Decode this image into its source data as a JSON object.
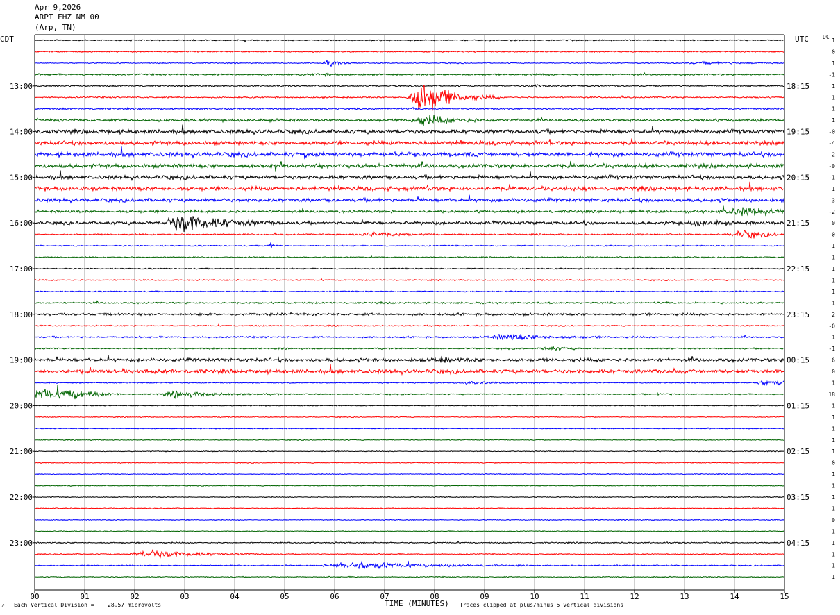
{
  "header": {
    "date": "Apr 9,2026",
    "station": "ARPT EHZ NM 00",
    "location": "(Arp, TN)"
  },
  "left_zone_label": "CDT",
  "right_zone_label": "UTC",
  "dc_label": "DC",
  "footer": {
    "scale_label": "Each Vertical Division =",
    "scale_value": "28.57 microvolts",
    "xlabel": "TIME (MINUTES)",
    "clip_note": "Traces clipped at plus/minus 5 vertical divisions",
    "corner_mark": "↗"
  },
  "colors": {
    "trace_cycle": [
      "#000000",
      "#ff0000",
      "#0000ff",
      "#006400"
    ],
    "grid": "#a0a0a0",
    "axis": "#000000"
  },
  "chart_data": {
    "type": "line",
    "title": "",
    "xlabel": "TIME (MINUTES)",
    "x_ticks": [
      "00",
      "01",
      "02",
      "03",
      "04",
      "05",
      "06",
      "07",
      "08",
      "09",
      "10",
      "11",
      "12",
      "13",
      "14",
      "15"
    ],
    "xlim": [
      0,
      15
    ],
    "trace_count": 48,
    "left_hour_labels": [
      {
        "trace": 4,
        "label": "13:00"
      },
      {
        "trace": 8,
        "label": "14:00"
      },
      {
        "trace": 12,
        "label": "15:00"
      },
      {
        "trace": 16,
        "label": "16:00"
      },
      {
        "trace": 20,
        "label": "17:00"
      },
      {
        "trace": 24,
        "label": "18:00"
      },
      {
        "trace": 28,
        "label": "19:00"
      },
      {
        "trace": 32,
        "label": "20:00"
      },
      {
        "trace": 36,
        "label": "21:00"
      },
      {
        "trace": 40,
        "label": "22:00"
      },
      {
        "trace": 44,
        "label": "23:00"
      }
    ],
    "right_hour_labels": [
      {
        "trace": 4,
        "label": "18:15"
      },
      {
        "trace": 8,
        "label": "19:15"
      },
      {
        "trace": 12,
        "label": "20:15"
      },
      {
        "trace": 16,
        "label": "21:15"
      },
      {
        "trace": 20,
        "label": "22:15"
      },
      {
        "trace": 24,
        "label": "23:15"
      },
      {
        "trace": 28,
        "label": "00:15"
      },
      {
        "trace": 32,
        "label": "01:15"
      },
      {
        "trace": 36,
        "label": "02:15"
      },
      {
        "trace": 40,
        "label": "03:15"
      },
      {
        "trace": 44,
        "label": "04:15"
      }
    ],
    "dc_offsets": [
      "1",
      "0",
      "1",
      "-1",
      "1",
      "1",
      "1",
      "1",
      "-0",
      "-4",
      "2",
      "-0",
      "-1",
      "1",
      "3",
      "-2",
      "0",
      "-0",
      "1",
      "1",
      "1",
      "1",
      "1",
      "1",
      "2",
      "-0",
      "1",
      "-1",
      "6",
      "0",
      "1",
      "18",
      "1",
      "1",
      "1",
      "1",
      "1",
      "0",
      "1",
      "1",
      "1",
      "1",
      "0",
      "1",
      "1",
      "1",
      "1",
      "1"
    ],
    "noise_levels": [
      1.0,
      1.0,
      0.8,
      1.4,
      1.2,
      1.2,
      1.4,
      2.2,
      3.2,
      3.2,
      3.6,
      3.4,
      3.2,
      3.2,
      3.0,
      2.2,
      2.6,
      1.2,
      1.0,
      1.0,
      1.0,
      1.0,
      1.0,
      1.4,
      2.0,
      1.0,
      1.4,
      1.2,
      2.8,
      3.4,
      0.9,
      1.0,
      0.7,
      0.7,
      0.7,
      0.7,
      0.7,
      0.7,
      0.7,
      0.7,
      0.7,
      0.7,
      0.7,
      0.7,
      1.0,
      0.9,
      0.9,
      0.8
    ],
    "events": [
      {
        "trace": 2,
        "minute": 5.9,
        "amplitude": 5,
        "duration": 0.3
      },
      {
        "trace": 2,
        "minute": 13.6,
        "amplitude": 2,
        "duration": 1.5
      },
      {
        "trace": 3,
        "minute": 5.7,
        "amplitude": 3,
        "duration": 0.3
      },
      {
        "trace": 4,
        "minute": 10.0,
        "amplitude": 3,
        "duration": 0.4
      },
      {
        "trace": 5,
        "minute": 7.8,
        "amplitude": 40,
        "duration": 0.6
      },
      {
        "trace": 7,
        "minute": 7.8,
        "amplitude": 10,
        "duration": 0.7
      },
      {
        "trace": 15,
        "minute": 14.2,
        "amplitude": 8,
        "duration": 0.8
      },
      {
        "trace": 16,
        "minute": 3.0,
        "amplitude": 22,
        "duration": 0.8
      },
      {
        "trace": 16,
        "minute": 13.3,
        "amplitude": 5,
        "duration": 0.5
      },
      {
        "trace": 17,
        "minute": 6.7,
        "amplitude": 6,
        "duration": 0.6
      },
      {
        "trace": 17,
        "minute": 14.2,
        "amplitude": 8,
        "duration": 0.6
      },
      {
        "trace": 18,
        "minute": 4.7,
        "amplitude": 9,
        "duration": 0.1
      },
      {
        "trace": 26,
        "minute": 9.5,
        "amplitude": 7,
        "duration": 0.9
      },
      {
        "trace": 27,
        "minute": 10.3,
        "amplitude": 6,
        "duration": 0.3
      },
      {
        "trace": 28,
        "minute": 8.1,
        "amplitude": 4,
        "duration": 0.4
      },
      {
        "trace": 30,
        "minute": 8.7,
        "amplitude": 3,
        "duration": 0.5
      },
      {
        "trace": 30,
        "minute": 14.7,
        "amplitude": 6,
        "duration": 0.6
      },
      {
        "trace": 31,
        "minute": 0.2,
        "amplitude": 14,
        "duration": 0.6
      },
      {
        "trace": 31,
        "minute": 0.8,
        "amplitude": 7,
        "duration": 0.4
      },
      {
        "trace": 31,
        "minute": 2.9,
        "amplitude": 6,
        "duration": 0.8
      },
      {
        "trace": 31,
        "minute": 12.5,
        "amplitude": 2,
        "duration": 0.3
      },
      {
        "trace": 45,
        "minute": 2.4,
        "amplitude": 9,
        "duration": 0.9
      },
      {
        "trace": 46,
        "minute": 6.5,
        "amplitude": 9,
        "duration": 1.3
      }
    ]
  }
}
